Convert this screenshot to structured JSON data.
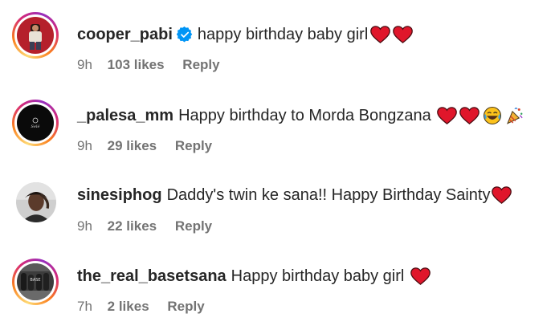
{
  "comments": [
    {
      "username": "cooper_pabi",
      "verified": true,
      "text": "happy birthday baby girl",
      "emojis": [
        "red-heart",
        "red-heart"
      ],
      "time": "9h",
      "likes": "103 likes",
      "reply": "Reply",
      "has_story_ring": true
    },
    {
      "username": "_palesa_mm",
      "verified": false,
      "text": "Happy birthday to Morda Bongzana",
      "emojis": [
        "red-heart",
        "red-heart",
        "tears-of-joy",
        "party-popper"
      ],
      "time": "9h",
      "likes": "29 likes",
      "reply": "Reply",
      "has_story_ring": true
    },
    {
      "username": "sinesiphog",
      "verified": false,
      "text": "Daddy's twin ke sana!! Happy Birthday Sainty",
      "emojis": [
        "red-heart"
      ],
      "time": "9h",
      "likes": "22 likes",
      "reply": "Reply",
      "has_story_ring": false
    },
    {
      "username": "the_real_basetsana",
      "verified": false,
      "text": "Happy birthday baby girl",
      "emojis": [
        "red-heart"
      ],
      "time": "7h",
      "likes": "2 likes",
      "reply": "Reply",
      "has_story_ring": true
    }
  ],
  "colors": {
    "text": "#262626",
    "meta": "#737373",
    "verified_blue": "#0095f6",
    "heart_red": "#e0162b"
  }
}
